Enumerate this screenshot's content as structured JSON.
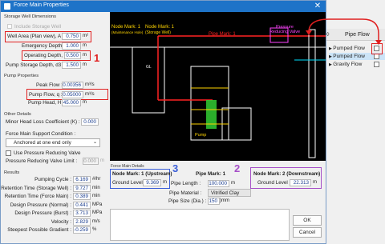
{
  "dialog_title": "Force Main Properties",
  "storage": {
    "section": "Storage Well Dimensions",
    "include": "Include Storage Well",
    "well_area": {
      "label": "Well Area (Plan view), A :",
      "value": "0.750",
      "unit": "m²"
    },
    "emergency": {
      "label": "Emergency Depth, d1 :",
      "value": "1.000",
      "unit": "m"
    },
    "operating": {
      "label": "Operating Depth, d2 :",
      "value": "0.500",
      "unit": "m"
    },
    "pump_storage": {
      "label": "Pump Storage Depth, d3 :",
      "value": "1.500",
      "unit": "m"
    }
  },
  "pump": {
    "section": "Pump Properties",
    "peak": {
      "label": "Peak Flow :",
      "value": "0.00356",
      "unit": "m³/s"
    },
    "pump_flow": {
      "label": "Pump Flow, q :",
      "value": "0.05000",
      "unit": "m³/s"
    },
    "head": {
      "label": "Pump Head, H :",
      "value": "45.000",
      "unit": "m"
    }
  },
  "other": {
    "section": "Other Details",
    "minor_loss": {
      "label": "Minor Head Loss Coefficient (K) :",
      "value": "0.000"
    },
    "support_label": "Force Main Support Condition :",
    "support_value": "Anchored at one end only",
    "prv_label": "Use Pressure Reducing Valve",
    "prv_limit_label": "Pressure Reducing Valve Limit :",
    "prv_limit_value": "0.000",
    "prv_limit_unit": "m"
  },
  "results": {
    "section": "Results",
    "rows": [
      {
        "label": "Pumping Cycle :",
        "value": "6.169",
        "unit": "#/hr"
      },
      {
        "label": "Retention Time (Storage Well) :",
        "value": "9.727",
        "unit": "min"
      },
      {
        "label": "Retention Time (Force Main) :",
        "value": "0.389",
        "unit": "min"
      },
      {
        "label": "Design Pressure (Normal) :",
        "value": "0.441",
        "unit": "MPa"
      },
      {
        "label": "Design Pressure (Burst) :",
        "value": "3.713",
        "unit": "MPa"
      },
      {
        "label": "Velocity :",
        "value": "2.829",
        "unit": "m/s"
      },
      {
        "label": "Steepest Possible Gradient :",
        "value": "-0.259",
        "unit": "%"
      }
    ]
  },
  "drawing": {
    "node1": "Node Mark: 1",
    "node1_sub": "(Maintenance Hole)",
    "node1_storage": "Node Mark: 1",
    "node1_storage_sub": "(Storage Well)",
    "pipe": "Pipe Mark: 1",
    "prv": "Pressure Reducing Valve",
    "gl": "GL",
    "pump": "Pump",
    "colors": {
      "bg": "#000000",
      "structure": "#ffffff",
      "pipe": "#ff2222",
      "water": "#ffd400",
      "pump": "#33cc33",
      "valve": "#ff44ff",
      "marker": "#00e0ff"
    }
  },
  "details": {
    "section": "Force Main Details",
    "upstream": {
      "title": "Node Mark: 1 (Upstream)",
      "gl_label": "Ground Level :",
      "gl_value": "9.369",
      "unit": "m"
    },
    "pipe": {
      "title": "Pipe Mark: 1",
      "length_label": "Pipe Length :",
      "length_value": "100.000",
      "length_unit": "m",
      "material_label": "Pipe Material :",
      "material_value": "Vitrified Clay (VC)",
      "size_label": "Pipe Size (Dia.) :",
      "size_value": "150",
      "size_unit": "mm"
    },
    "downstream": {
      "title": "Node Mark: 2 (Downstream)",
      "gl_label": "Ground Level :",
      "gl_value": "22.313",
      "unit": "m"
    }
  },
  "buttons": {
    "ok": "OK",
    "cancel": "Cancel"
  },
  "annotations": {
    "n1": "1",
    "n2": "2",
    "n3": "3"
  },
  "right_panel": {
    "header": "Pipe Flow",
    "rows": [
      "Pumped Flow",
      "Pumped Flow",
      "Gravity Flow"
    ]
  }
}
